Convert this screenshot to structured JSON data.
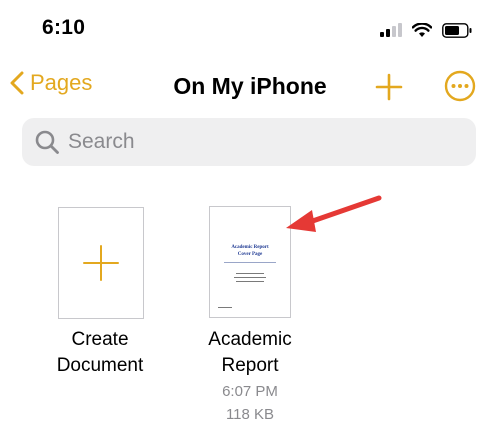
{
  "status_bar": {
    "time": "6:10"
  },
  "nav": {
    "back_label": "Pages",
    "title": "On My iPhone"
  },
  "search": {
    "placeholder": "Search"
  },
  "items": [
    {
      "label_line1": "Create",
      "label_line2": "Document"
    },
    {
      "label_line1": "Academic",
      "label_line2": "Report",
      "time": "6:07 PM",
      "size": "118 KB"
    }
  ],
  "thumbnail": {
    "title_line1": "Academic Report",
    "title_line2": "Cover Page"
  },
  "colors": {
    "accent": "#e3a81f",
    "arrow": "#e53935"
  }
}
